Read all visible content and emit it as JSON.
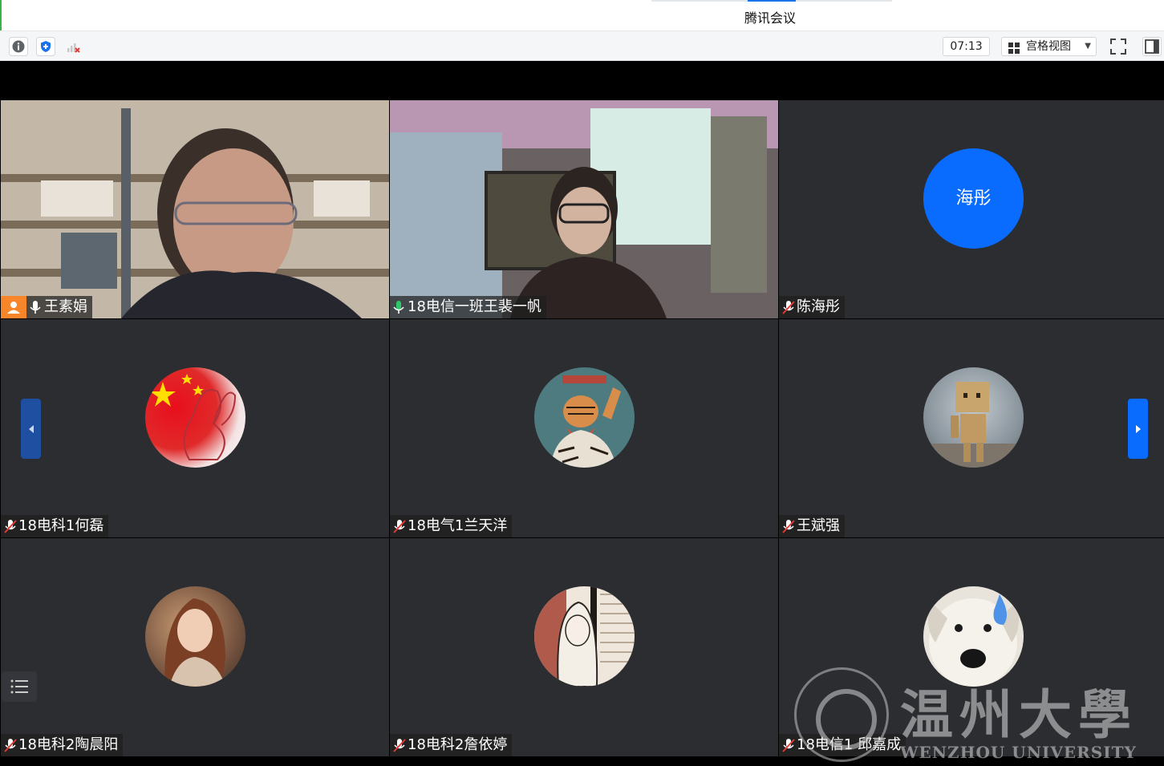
{
  "window": {
    "title": "腾讯会议"
  },
  "toolbar": {
    "info_icon": "info-icon",
    "shield_icon": "shield-icon",
    "network_icon": "network-signal-icon",
    "timer": "07:13",
    "view_mode": "宫格视图",
    "fullscreen_icon": "fullscreen-icon",
    "sidebar_icon": "sidebar-toggle-icon"
  },
  "participants": [
    {
      "name": "王素娟",
      "mic": "on",
      "host": true,
      "type": "video"
    },
    {
      "name": "18电信一班王裴一帆",
      "mic": "on",
      "type": "video",
      "speaking": true
    },
    {
      "name": "陈海彤",
      "mic": "muted",
      "type": "avatar-text",
      "avatar_text": "海彤"
    },
    {
      "name": "18电科1何磊",
      "mic": "muted",
      "type": "avatar-image",
      "avatar_desc": "flag-bunny-avatar"
    },
    {
      "name": "18电气1兰天洋",
      "mic": "muted",
      "type": "avatar-image",
      "avatar_desc": "tiger-avatar"
    },
    {
      "name": "王斌强",
      "mic": "muted",
      "type": "avatar-image",
      "avatar_desc": "cardboard-robot-avatar"
    },
    {
      "name": "18电科2陶晨阳",
      "mic": "muted",
      "type": "avatar-image",
      "avatar_desc": "anime-girl-avatar"
    },
    {
      "name": "18电科2詹依婷",
      "mic": "muted",
      "type": "avatar-image",
      "avatar_desc": "ink-girl-avatar"
    },
    {
      "name": "18电信1 邱嘉成",
      "mic": "muted",
      "type": "avatar-image",
      "avatar_desc": "white-dog-avatar"
    }
  ],
  "watermark": {
    "cn": "温州大學",
    "en": "WENZHOU UNIVERSITY"
  },
  "colors": {
    "accent": "#0a6cff",
    "host_badge": "#f7862a",
    "tile_bg": "#2b2d31",
    "speaking_border": "#2ec76a"
  }
}
